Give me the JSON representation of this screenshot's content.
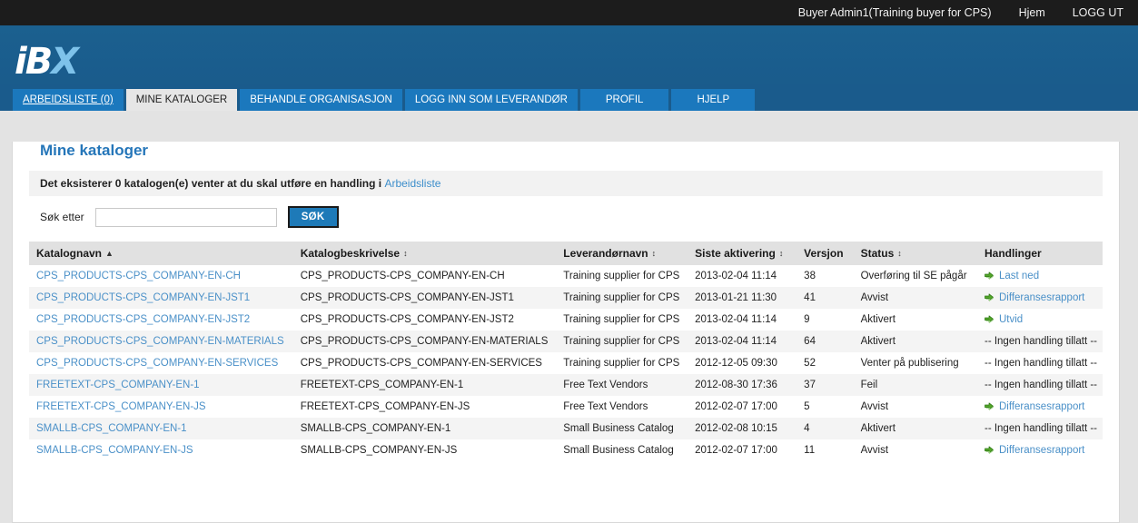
{
  "topbar": {
    "user": "Buyer Admin1(Training buyer for CPS)",
    "home_label": "Hjem",
    "logout_label": "LOGG UT"
  },
  "brand": {
    "logo_part1": "iB",
    "logo_part2": "X"
  },
  "tabs": [
    {
      "label": "ARBEIDSLISTE (0)",
      "active": false,
      "underline": true
    },
    {
      "label": "MINE KATALOGER",
      "active": true,
      "underline": false
    },
    {
      "label": "BEHANDLE ORGANISASJON",
      "active": false,
      "underline": false
    },
    {
      "label": "LOGG INN SOM LEVERANDØR",
      "active": false,
      "underline": false
    },
    {
      "label": "PROFIL",
      "active": false,
      "underline": false
    },
    {
      "label": "HJELP",
      "active": false,
      "underline": false
    }
  ],
  "page": {
    "title": "Mine kataloger",
    "info_text": "Det eksisterer 0 katalogen(e) venter at du skal utføre en handling i ",
    "info_link": "Arbeidsliste"
  },
  "search": {
    "label": "Søk etter",
    "value": "",
    "placeholder": "",
    "button_label": "SØK"
  },
  "table": {
    "columns": [
      {
        "label": "Katalognavn",
        "sort": "asc"
      },
      {
        "label": "Katalogbeskrivelse",
        "sort": "both"
      },
      {
        "label": "Leverandørnavn",
        "sort": "both"
      },
      {
        "label": "Siste aktivering",
        "sort": "both"
      },
      {
        "label": "Versjon",
        "sort": "none"
      },
      {
        "label": "Status",
        "sort": "both"
      },
      {
        "label": "Handlinger",
        "sort": "none"
      }
    ],
    "rows": [
      {
        "name": "CPS_PRODUCTS-CPS_COMPANY-EN-CH",
        "description": "CPS_PRODUCTS-CPS_COMPANY-EN-CH",
        "vendor": "Training supplier for CPS",
        "activation": "2013-02-04 11:14",
        "version": "38",
        "status": "Overføring til SE pågår",
        "action": "Last ned",
        "action_type": "link"
      },
      {
        "name": "CPS_PRODUCTS-CPS_COMPANY-EN-JST1",
        "description": "CPS_PRODUCTS-CPS_COMPANY-EN-JST1",
        "vendor": "Training supplier for CPS",
        "activation": "2013-01-21 11:30",
        "version": "41",
        "status": "Avvist",
        "action": "Differansesrapport",
        "action_type": "link"
      },
      {
        "name": "CPS_PRODUCTS-CPS_COMPANY-EN-JST2",
        "description": "CPS_PRODUCTS-CPS_COMPANY-EN-JST2",
        "vendor": "Training supplier for CPS",
        "activation": "2013-02-04 11:14",
        "version": "9",
        "status": "Aktivert",
        "action": "Utvid",
        "action_type": "link"
      },
      {
        "name": "CPS_PRODUCTS-CPS_COMPANY-EN-MATERIALS",
        "description": "CPS_PRODUCTS-CPS_COMPANY-EN-MATERIALS",
        "vendor": "Training supplier for CPS",
        "activation": "2013-02-04 11:14",
        "version": "64",
        "status": "Aktivert",
        "action": "-- Ingen handling tillatt --",
        "action_type": "none"
      },
      {
        "name": "CPS_PRODUCTS-CPS_COMPANY-EN-SERVICES",
        "description": "CPS_PRODUCTS-CPS_COMPANY-EN-SERVICES",
        "vendor": "Training supplier for CPS",
        "activation": "2012-12-05 09:30",
        "version": "52",
        "status": "Venter på publisering",
        "action": "-- Ingen handling tillatt --",
        "action_type": "none"
      },
      {
        "name": "FREETEXT-CPS_COMPANY-EN-1",
        "description": "FREETEXT-CPS_COMPANY-EN-1",
        "vendor": "Free Text Vendors",
        "activation": "2012-08-30 17:36",
        "version": "37",
        "status": "Feil",
        "action": "-- Ingen handling tillatt --",
        "action_type": "none"
      },
      {
        "name": "FREETEXT-CPS_COMPANY-EN-JS",
        "description": "FREETEXT-CPS_COMPANY-EN-JS",
        "vendor": "Free Text Vendors",
        "activation": "2012-02-07 17:00",
        "version": "5",
        "status": "Avvist",
        "action": "Differansesrapport",
        "action_type": "link"
      },
      {
        "name": "SMALLB-CPS_COMPANY-EN-1",
        "description": "SMALLB-CPS_COMPANY-EN-1",
        "vendor": "Small Business Catalog",
        "activation": "2012-02-08 10:15",
        "version": "4",
        "status": "Aktivert",
        "action": "-- Ingen handling tillatt --",
        "action_type": "none"
      },
      {
        "name": "SMALLB-CPS_COMPANY-EN-JS",
        "description": "SMALLB-CPS_COMPANY-EN-JS",
        "vendor": "Small Business Catalog",
        "activation": "2012-02-07 17:00",
        "version": "11",
        "status": "Avvist",
        "action": "Differansesrapport",
        "action_type": "link"
      }
    ]
  },
  "colors": {
    "topbar_bg": "#1c1c1c",
    "brand_bg": "#1a5b8c",
    "tab_bg": "#1b78bd",
    "tab_active_bg": "#e6e6e6",
    "link_blue": "#4a90c8",
    "title_blue": "#2576b9",
    "arrow_green": "#53a629"
  }
}
